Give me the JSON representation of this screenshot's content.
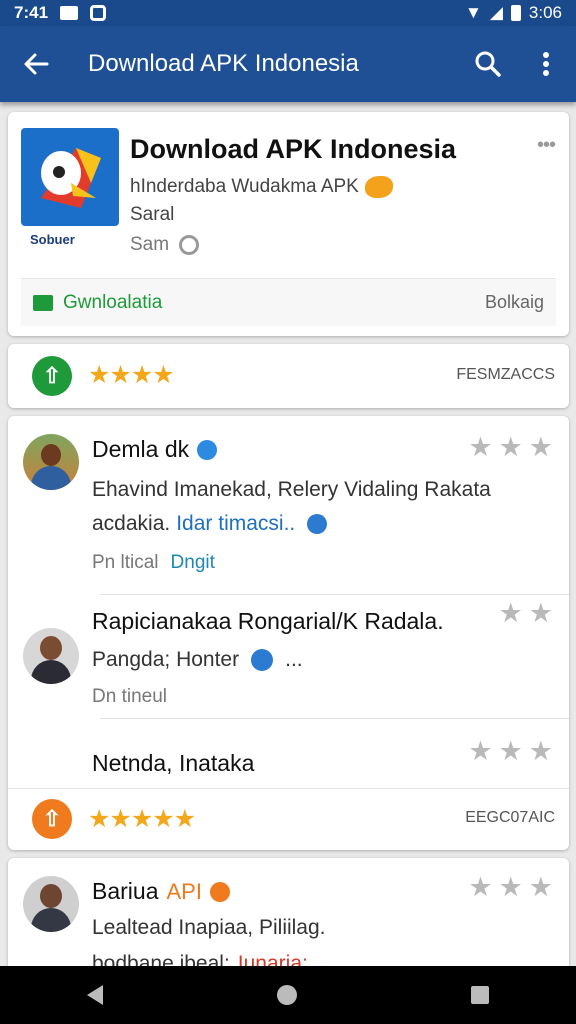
{
  "status_bar": {
    "left_time": "7:41",
    "right_time": "3:06"
  },
  "app_bar": {
    "title": "Download APK Indonesia"
  },
  "app_card": {
    "title": "Download APK Indonesia",
    "subtitle": "hInderdaba Wudakma APK",
    "line2": "Saral",
    "line3": "Sam",
    "logo_caption": "Sobuer",
    "download_label": "Gwnloalatia",
    "download_right": "Bolkaig"
  },
  "rating_row_1": {
    "stars": "★★★★",
    "rating": 4,
    "right": "FESMZACCS"
  },
  "reviews": [
    {
      "name": "Demla dk",
      "text1": "Ehavind Imanekad, Relery Vidaling Rakata",
      "text2": "acdakia.",
      "text2_link": "Idar timacsi..",
      "meta": "Pn ltical",
      "meta_link": "Dngit",
      "stars": "★★★"
    },
    {
      "name": "Rapicianakaa Rongarial/K Radala.",
      "text1": "Pangda; Honter",
      "text2_extra": "...",
      "meta": "Dn tineul",
      "stars": "★★"
    },
    {
      "name": "Netnda, Inataka",
      "stars": "★★★"
    }
  ],
  "rating_row_2": {
    "stars": "★★★★★",
    "rating": 5,
    "right": "EEGC07AIC"
  },
  "review_4": {
    "name": "Bariua",
    "tag": "API",
    "text1": "Lealtead Inapiaa, Piliilag.",
    "text2": "bodbane ibeal;",
    "text2_link": "Iunaria:",
    "stars": "★★★"
  },
  "colors": {
    "app_bar": "#1f4f95",
    "status_bar": "#1a4a8c",
    "star": "#f3a81c",
    "green": "#1e9a3a",
    "orange": "#f07a1e",
    "link_blue": "#1e6fbf",
    "link_red": "#d23a2a"
  }
}
